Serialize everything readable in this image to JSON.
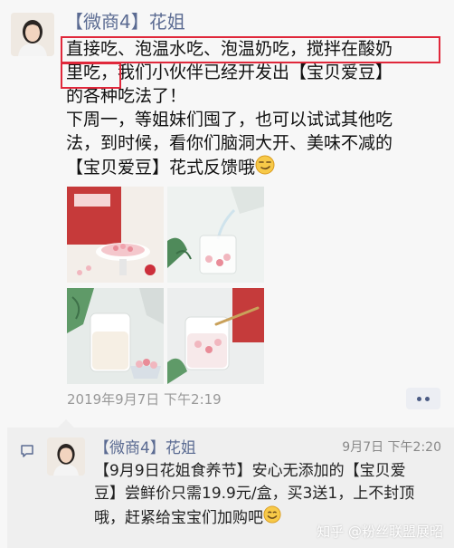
{
  "post": {
    "author": "【微商4】花姐",
    "text_lines": [
      "直接吃、泡温水吃、泡温奶吃，搅拌在酸奶",
      "里吃，我们小伙伴已经开发出【宝贝爱豆】",
      "的各种吃法了！",
      "下周一，等姐妹们囤了，也可以试试其他吃",
      "法，到时候，看你们脑洞大开、美味不减的",
      "【宝贝爱豆】花式反馈哦"
    ],
    "emoji": "smirk-emoji",
    "photos": [
      "bowl-of-yogurt-bites",
      "pouring-water-glass",
      "glass-with-milk",
      "cup-with-yogurt"
    ],
    "timestamp": "2019年9月7日  下午2:19",
    "more_button": "more-options"
  },
  "comment": {
    "author": "【微商4】花姐",
    "time": "9月7日  下午2:20",
    "text_lines": [
      "【9月9日花姐食养节】安心无添加的【宝贝爱",
      "豆】尝鲜价只需19.9元/盒，买3送1，上不封顶",
      "哦，赶紧给宝宝们加购吧"
    ],
    "emoji": "smile-emoji"
  },
  "watermark": "知乎 @粉丝联盟展昭",
  "colors": {
    "accent_name": "#5b6b92",
    "highlight": "#e0283b",
    "background": "#f7f7f7"
  }
}
